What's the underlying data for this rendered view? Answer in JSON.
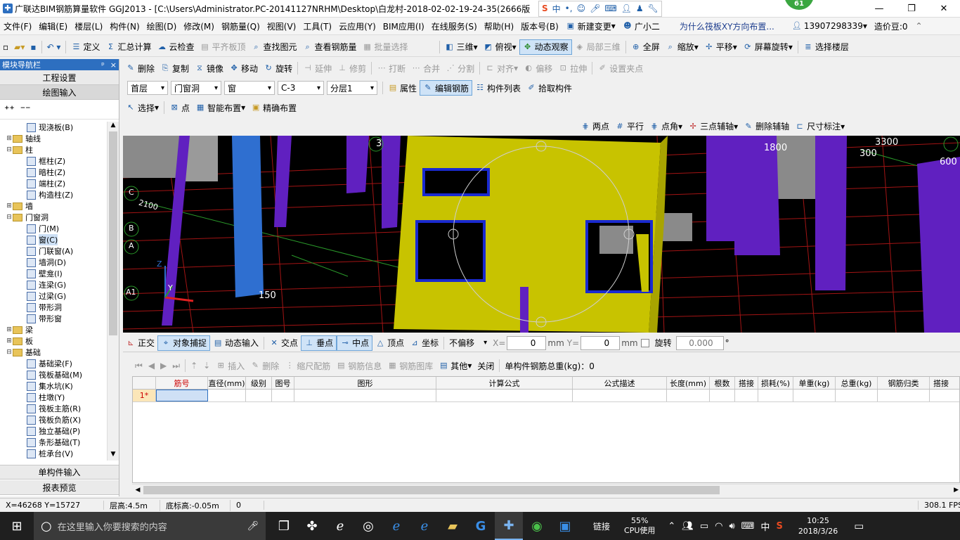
{
  "title": {
    "text": "广联达BIM钢筋算量软件 GGJ2013 - [C:\\Users\\Administrator.PC-20141127NRHM\\Desktop\\白龙村-2018-02-02-19-24-35(2666版",
    "badge": "61",
    "ime_items": [
      "中",
      "•,"
    ]
  },
  "menu": [
    "文件(F)",
    "编辑(E)",
    "楼层(L)",
    "构件(N)",
    "绘图(D)",
    "修改(M)",
    "钢筋量(Q)",
    "视图(V)",
    "工具(T)",
    "云应用(Y)",
    "BIM应用(I)",
    "在线服务(S)",
    "帮助(H)",
    "版本号(B)",
    "新建变更",
    "广小二"
  ],
  "menu_right": {
    "question": "为什么筏板XY方向布置...",
    "phone": "13907298339",
    "price": "造价豆:0"
  },
  "toolbar1": [
    "定义",
    "汇总计算",
    "云检查",
    "平齐板顶",
    "查找图元",
    "查看钢筋量",
    "批量选择",
    "三维",
    "俯视",
    "动态观察",
    "局部三维",
    "全屏",
    "缩放",
    "平移",
    "屏幕旋转",
    "选择楼层"
  ],
  "toolbar2": [
    "删除",
    "复制",
    "镜像",
    "移动",
    "旋转",
    "延伸",
    "修剪",
    "打断",
    "合并",
    "分割",
    "对齐",
    "偏移",
    "拉伸",
    "设置夹点"
  ],
  "toolbar3": {
    "floor": "首层",
    "category": "门窗洞",
    "type": "窗",
    "element": "C-3",
    "layer": "分层1",
    "buttons": [
      "属性",
      "编辑钢筋",
      "构件列表",
      "拾取构件"
    ]
  },
  "toolbar4": [
    "选择",
    "点",
    "智能布置",
    "精确布置"
  ],
  "axis_toolbar": [
    "两点",
    "平行",
    "点角",
    "三点辅轴",
    "删除辅轴",
    "尺寸标注"
  ],
  "left_panel": {
    "header": "模块导航栏",
    "pin": "ᵖ",
    "close": "×",
    "top_buttons": [
      "工程设置",
      "绘图输入"
    ],
    "tree": [
      {
        "label": "现浇板(B)",
        "level": 2,
        "kind": "item"
      },
      {
        "label": "轴线",
        "level": 0,
        "kind": "folder",
        "exp": "+"
      },
      {
        "label": "柱",
        "level": 0,
        "kind": "folder",
        "exp": "−"
      },
      {
        "label": "框柱(Z)",
        "level": 2,
        "kind": "item"
      },
      {
        "label": "暗柱(Z)",
        "level": 2,
        "kind": "item"
      },
      {
        "label": "端柱(Z)",
        "level": 2,
        "kind": "item"
      },
      {
        "label": "构造柱(Z)",
        "level": 2,
        "kind": "item"
      },
      {
        "label": "墙",
        "level": 0,
        "kind": "folder",
        "exp": "+"
      },
      {
        "label": "门窗洞",
        "level": 0,
        "kind": "folder",
        "exp": "−"
      },
      {
        "label": "门(M)",
        "level": 2,
        "kind": "item"
      },
      {
        "label": "窗(C)",
        "level": 2,
        "kind": "item",
        "selected": true
      },
      {
        "label": "门联窗(A)",
        "level": 2,
        "kind": "item"
      },
      {
        "label": "墙洞(D)",
        "level": 2,
        "kind": "item"
      },
      {
        "label": "壁龛(I)",
        "level": 2,
        "kind": "item"
      },
      {
        "label": "连梁(G)",
        "level": 2,
        "kind": "item"
      },
      {
        "label": "过梁(G)",
        "level": 2,
        "kind": "item"
      },
      {
        "label": "带形洞",
        "level": 2,
        "kind": "item"
      },
      {
        "label": "带形窗",
        "level": 2,
        "kind": "item"
      },
      {
        "label": "梁",
        "level": 0,
        "kind": "folder",
        "exp": "+"
      },
      {
        "label": "板",
        "level": 0,
        "kind": "folder",
        "exp": "+"
      },
      {
        "label": "基础",
        "level": 0,
        "kind": "folder",
        "exp": "−"
      },
      {
        "label": "基础梁(F)",
        "level": 2,
        "kind": "item"
      },
      {
        "label": "筏板基础(M)",
        "level": 2,
        "kind": "item"
      },
      {
        "label": "集水坑(K)",
        "level": 2,
        "kind": "item"
      },
      {
        "label": "柱墩(Y)",
        "level": 2,
        "kind": "item"
      },
      {
        "label": "筏板主筋(R)",
        "level": 2,
        "kind": "item"
      },
      {
        "label": "筏板负筋(X)",
        "level": 2,
        "kind": "item"
      },
      {
        "label": "独立基础(P)",
        "level": 2,
        "kind": "item"
      },
      {
        "label": "条形基础(T)",
        "level": 2,
        "kind": "item"
      },
      {
        "label": "桩承台(V)",
        "level": 2,
        "kind": "item"
      }
    ],
    "bottom_buttons": [
      "单构件输入",
      "报表预览"
    ]
  },
  "canvas": {
    "axis_labels": [
      "C",
      "B",
      "A",
      "A1"
    ],
    "dims": [
      "3300",
      "1800",
      "300",
      "600",
      "2100",
      "150",
      "3"
    ],
    "z_label": "Z",
    "y_label": "Y"
  },
  "snap_bar": {
    "items": [
      "正交",
      "对象捕捉",
      "动态输入",
      "交点",
      "垂点",
      "中点",
      "顶点",
      "坐标"
    ],
    "offset_mode": "不偏移",
    "x_label": "X=",
    "x_value": "0",
    "y_label": "Y=",
    "y_value": "0",
    "unit": "mm",
    "rotate_label": "旋转",
    "rotate_value": "0.000",
    "degree": "°"
  },
  "grid_toolbar": {
    "items": [
      "插入",
      "删除",
      "缩尺配筋",
      "钢筋信息",
      "钢筋图库",
      "其他",
      "关闭"
    ],
    "total_label": "单构件钢筋总重(kg)：0"
  },
  "grid": {
    "columns": [
      "筋号",
      "直径(mm)",
      "级别",
      "图号",
      "图形",
      "计算公式",
      "公式描述",
      "长度(mm)",
      "根数",
      "搭接",
      "损耗(%)",
      "单重(kg)",
      "总重(kg)",
      "钢筋归类",
      "搭接"
    ],
    "row_header": "1*"
  },
  "status": {
    "coords": "X=46268 Y=15727",
    "floor_height": "层高:4.5m",
    "base_height": "底标高:-0.05m",
    "value": "0",
    "fps": "308.1 FPS"
  },
  "taskbar": {
    "search_placeholder": "在这里输入你要搜索的内容",
    "link": "链接",
    "cpu_pct": "55%",
    "cpu_label": "CPU使用",
    "lang": "中",
    "time": "10:25",
    "date": "2018/3/26"
  }
}
